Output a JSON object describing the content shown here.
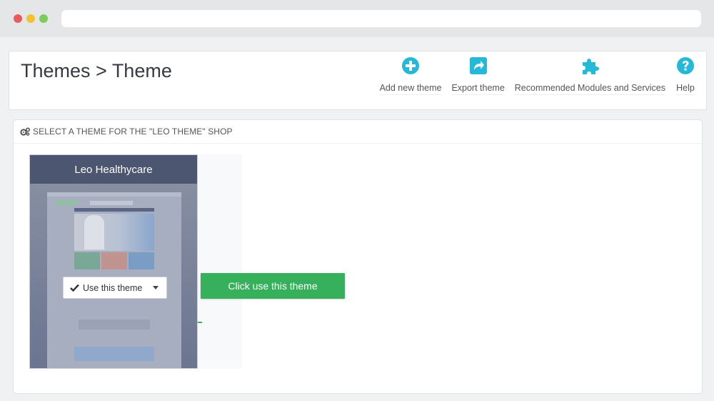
{
  "browser": {
    "traffic_lights": [
      "close",
      "minimize",
      "maximize"
    ],
    "url": ""
  },
  "header": {
    "title": "Themes > Theme",
    "toolbar": [
      {
        "label": "Add new theme",
        "icon": "plus-circle-icon"
      },
      {
        "label": "Export theme",
        "icon": "share-icon"
      },
      {
        "label": "Recommended Modules and Services",
        "icon": "puzzle-icon"
      },
      {
        "label": "Help",
        "icon": "question-circle-icon"
      }
    ]
  },
  "panel": {
    "icon": "cogs-icon",
    "title": "SELECT A THEME FOR THE \"LEO THEME\" SHOP"
  },
  "theme_card": {
    "name": "Leo Healthycare",
    "use_button_label": "Use this theme"
  },
  "callout": {
    "text": "Click use this theme"
  },
  "colors": {
    "accent": "#25b9d7",
    "callout_green": "#36b05a",
    "card_header": "#4d5670"
  }
}
